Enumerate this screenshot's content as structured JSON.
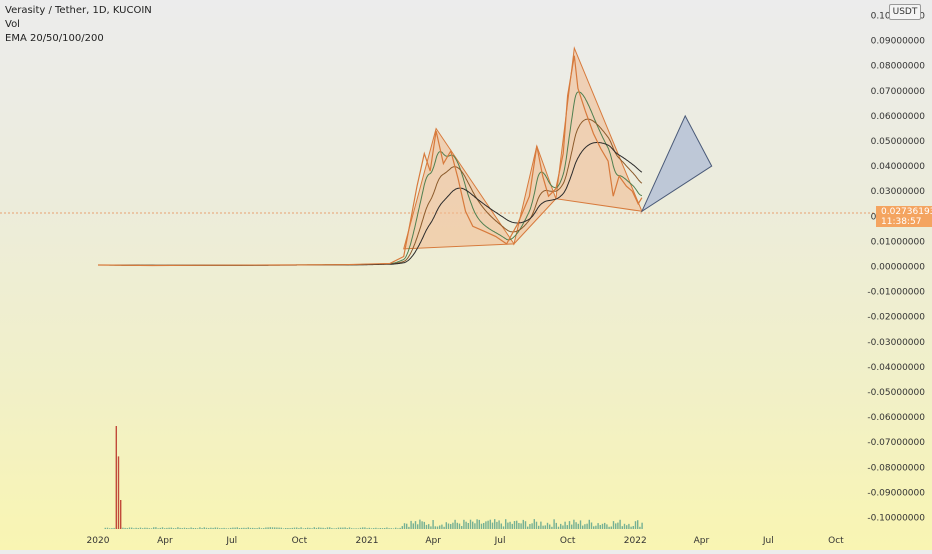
{
  "legend": {
    "symbol": "Verasity / Tether, 1D, KUCOIN",
    "vol": "Vol",
    "ema": "EMA 20/50/100/200"
  },
  "currency": "USDT",
  "last_price": {
    "value": "0.02736193",
    "countdown": "11:38:57"
  },
  "colors": {
    "price_line": "#d77a3c",
    "ema_black": "#2b2b2b",
    "ema_brown": "#8b5a2b",
    "ema_green": "#4f7f4f",
    "pattern_fill": "#f2b98e",
    "pattern_stroke": "#d77a3c",
    "projection_fill": "#b6c2d6",
    "volume": "#4a9a8a"
  },
  "chart_data": {
    "type": "line",
    "title": "Verasity / Tether, 1D, KUCOIN",
    "x_type": "date",
    "x_tick_labels": [
      "2020",
      "Apr",
      "Jul",
      "Oct",
      "2021",
      "Apr",
      "Jul",
      "Oct",
      "2022",
      "Apr",
      "Jul",
      "Oct"
    ],
    "x_ticks": [
      "2020-01-01",
      "2020-04-01",
      "2020-07-01",
      "2020-10-01",
      "2021-01-01",
      "2021-04-01",
      "2021-07-01",
      "2021-10-01",
      "2022-01-01",
      "2022-04-01",
      "2022-07-01",
      "2022-10-01"
    ],
    "y_tick_labels": [
      "0.10000000",
      "0.09000000",
      "0.08000000",
      "0.07000000",
      "0.06000000",
      "0.05000000",
      "0.04000000",
      "0.03000000",
      "0.02000000",
      "0.01000000",
      "0.00000000",
      "-0.01000000",
      "-0.02000000",
      "-0.03000000",
      "-0.04000000",
      "-0.05000000",
      "-0.06000000",
      "-0.07000000",
      "-0.08000000",
      "-0.09000000",
      "-0.10000000"
    ],
    "ylim": [
      -0.1,
      0.1
    ],
    "series": [
      {
        "name": "Verasity / Tether",
        "points": [
          [
            "2020-01-01",
            0.0006
          ],
          [
            "2020-03-15",
            0.0004
          ],
          [
            "2020-06-01",
            0.0005
          ],
          [
            "2020-09-01",
            0.0006
          ],
          [
            "2020-12-01",
            0.0007
          ],
          [
            "2021-02-01",
            0.0012
          ],
          [
            "2021-02-20",
            0.004
          ],
          [
            "2021-03-01",
            0.018
          ],
          [
            "2021-03-10",
            0.032
          ],
          [
            "2021-03-20",
            0.045
          ],
          [
            "2021-03-28",
            0.038
          ],
          [
            "2021-04-05",
            0.054
          ],
          [
            "2021-04-15",
            0.041
          ],
          [
            "2021-04-25",
            0.046
          ],
          [
            "2021-05-05",
            0.035
          ],
          [
            "2021-05-15",
            0.022
          ],
          [
            "2021-05-25",
            0.016
          ],
          [
            "2021-06-10",
            0.014
          ],
          [
            "2021-06-25",
            0.012
          ],
          [
            "2021-07-10",
            0.009
          ],
          [
            "2021-07-25",
            0.017
          ],
          [
            "2021-08-10",
            0.028
          ],
          [
            "2021-08-20",
            0.048
          ],
          [
            "2021-08-28",
            0.036
          ],
          [
            "2021-09-05",
            0.028
          ],
          [
            "2021-09-15",
            0.031
          ],
          [
            "2021-09-25",
            0.045
          ],
          [
            "2021-10-01",
            0.068
          ],
          [
            "2021-10-10",
            0.084
          ],
          [
            "2021-10-15",
            0.071
          ],
          [
            "2021-10-25",
            0.062
          ],
          [
            "2021-11-05",
            0.053
          ],
          [
            "2021-11-15",
            0.047
          ],
          [
            "2021-11-25",
            0.042
          ],
          [
            "2021-12-02",
            0.028
          ],
          [
            "2021-12-10",
            0.036
          ],
          [
            "2021-12-20",
            0.032
          ],
          [
            "2021-12-28",
            0.03
          ],
          [
            "2022-01-05",
            0.025
          ],
          [
            "2022-01-10",
            0.0274
          ]
        ]
      }
    ],
    "patterns": [
      {
        "points": [
          [
            "2021-02-20",
            0.007
          ],
          [
            "2021-04-05",
            0.055
          ],
          [
            "2021-07-20",
            0.009
          ]
        ]
      },
      {
        "points": [
          [
            "2021-07-20",
            0.009
          ],
          [
            "2021-08-20",
            0.048
          ],
          [
            "2021-09-15",
            0.027
          ]
        ]
      },
      {
        "points": [
          [
            "2021-09-15",
            0.027
          ],
          [
            "2021-10-10",
            0.087
          ],
          [
            "2022-01-10",
            0.022
          ]
        ]
      }
    ],
    "projection": {
      "points": [
        [
          "2022-01-10",
          0.022
        ],
        [
          "2022-03-10",
          0.06
        ],
        [
          "2022-04-15",
          0.04
        ]
      ]
    },
    "volume": {
      "spike_dates": [
        "2020-01-25",
        "2020-01-28",
        "2020-01-31"
      ],
      "spike_levels": [
        0.78,
        0.55,
        0.22
      ]
    },
    "grid": false,
    "y_axis_position": "right"
  }
}
